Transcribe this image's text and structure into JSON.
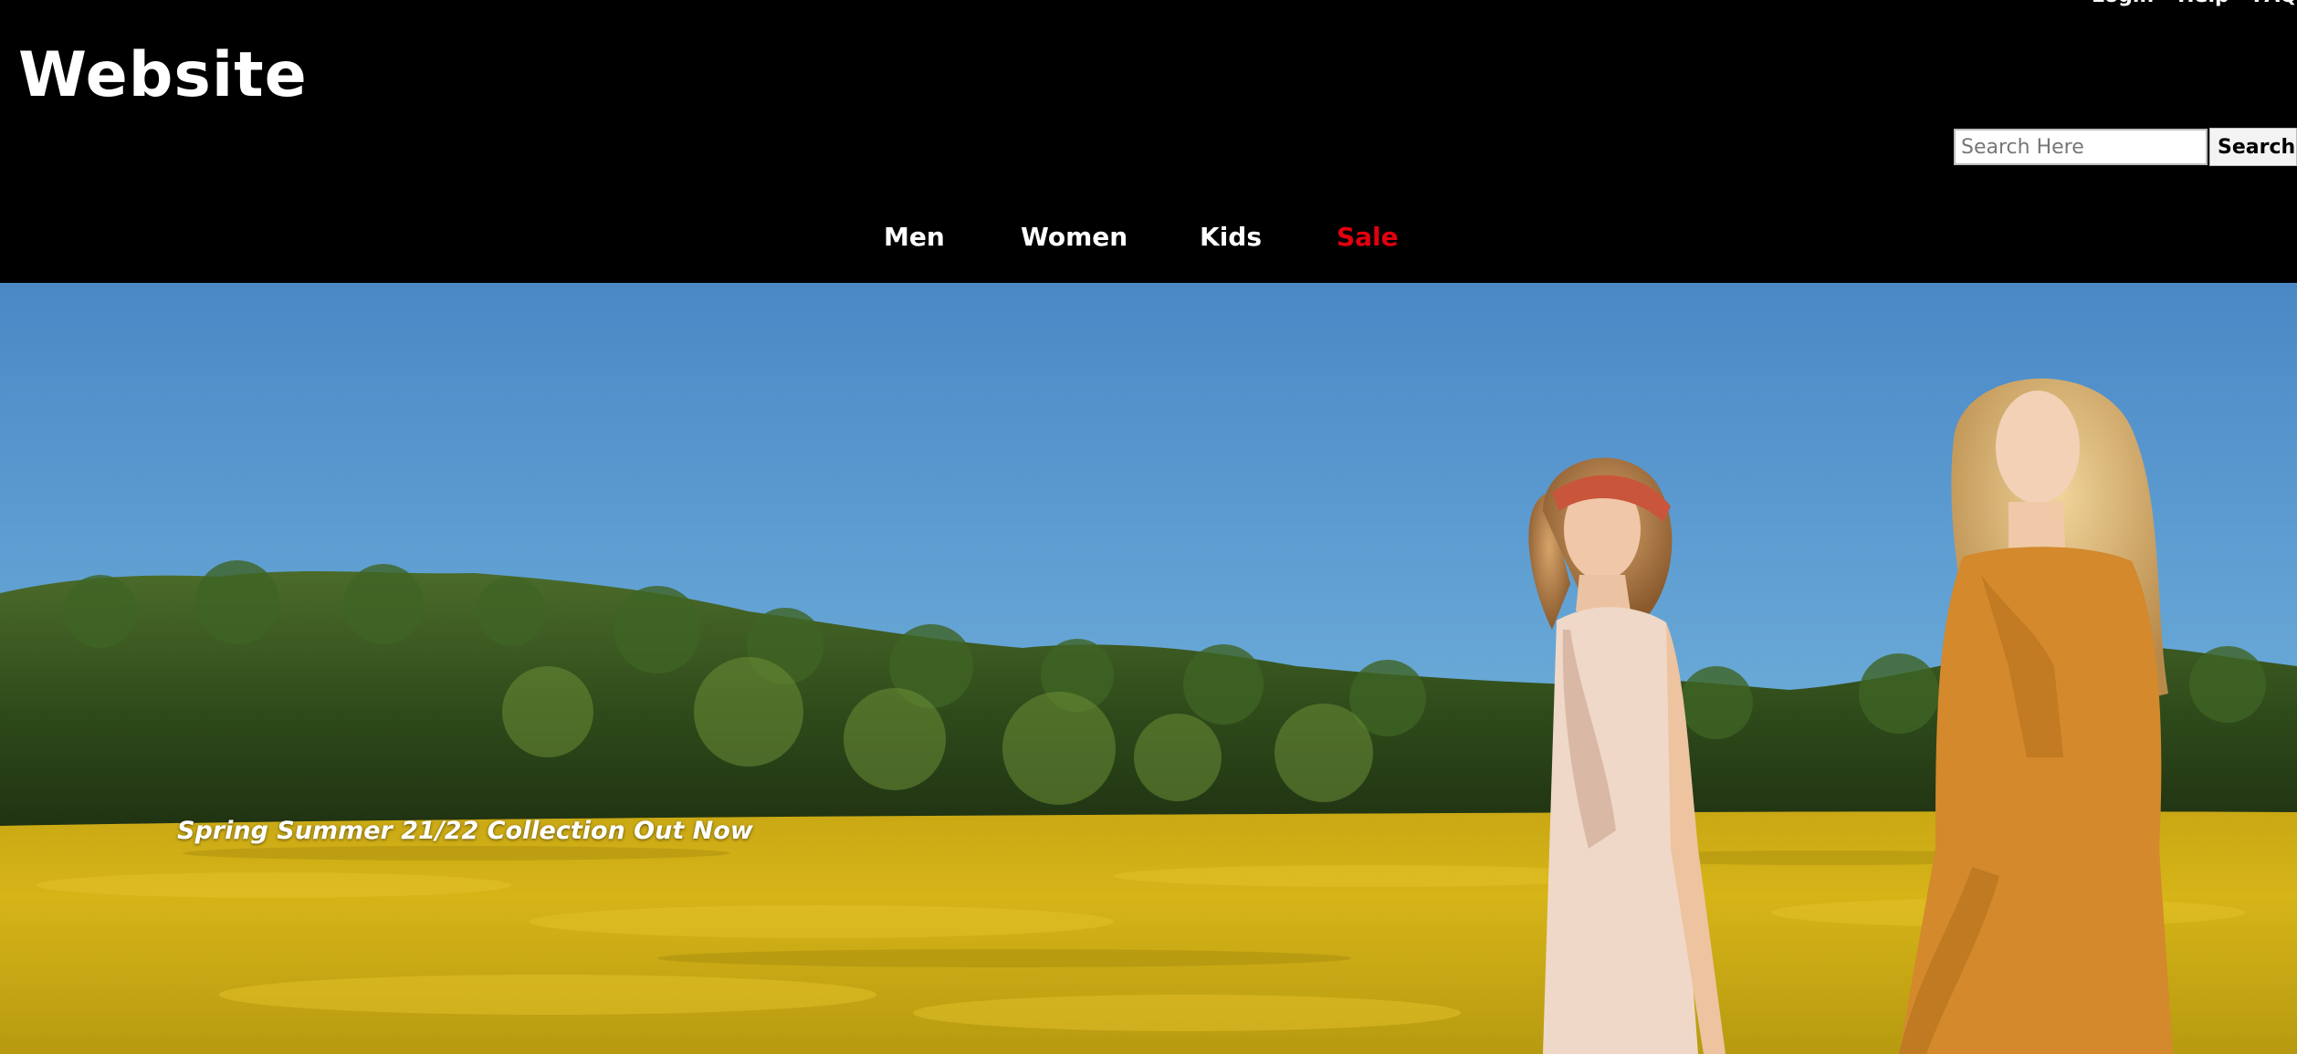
{
  "header": {
    "logo": "Website",
    "top_links": [
      "Login",
      "Help",
      "FAQ"
    ]
  },
  "search": {
    "placeholder": "Search Here",
    "value": "",
    "button_label": "Search"
  },
  "nav": {
    "items": [
      {
        "label": "Men"
      },
      {
        "label": "Women"
      },
      {
        "label": "Kids"
      },
      {
        "label": "Sale"
      }
    ],
    "sale_color": "#e3000f"
  },
  "hero": {
    "caption": "Spring Summer 21/22 Collection Out Now",
    "image_icon": "hero-banner-image"
  },
  "colors": {
    "background": "#000000",
    "text": "#ffffff",
    "accent": "#e3000f"
  }
}
